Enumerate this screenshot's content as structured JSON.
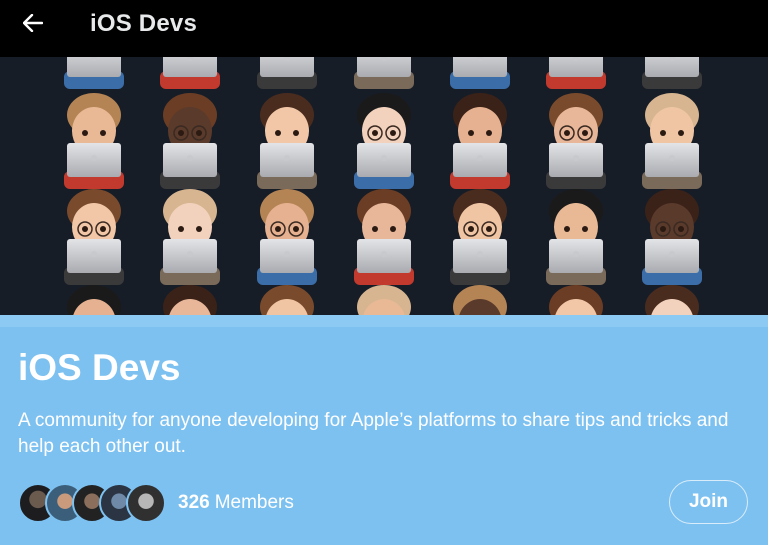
{
  "header": {
    "back_icon": "arrow-left-icon",
    "title": "iOS Devs"
  },
  "banner": {
    "description_icon": "memoji-developers-banner"
  },
  "community": {
    "name": "iOS Devs",
    "description": "A community for anyone developing for Apple’s platforms to share tips and tricks and help each other out.",
    "member_count": "326",
    "members_label": "Members",
    "join_label": "Join"
  },
  "colors": {
    "header_bg": "#000000",
    "banner_bg": "#171d27",
    "panel_bg": "#7dc1f1",
    "text": "#ffffff"
  }
}
